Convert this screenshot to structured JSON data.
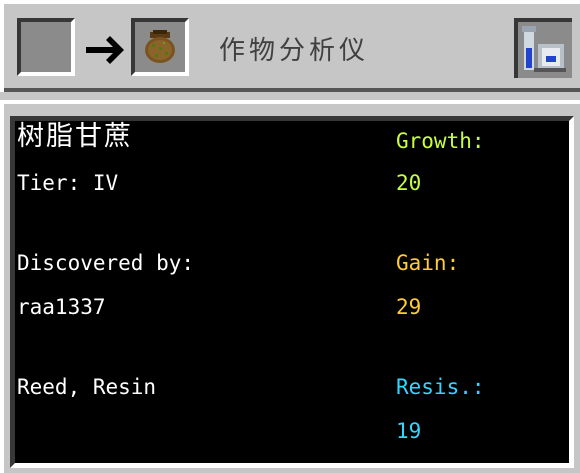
{
  "window": {
    "title": "作物分析仪"
  },
  "crop": {
    "name": "树脂甘蔗",
    "tier_text": "Tier: IV",
    "discovered_label": "Discovered by:",
    "discovered_by": "raa1337",
    "attributes": "Reed, Resin"
  },
  "stats": {
    "growth_label": "Growth:",
    "growth_value": "20",
    "gain_label": "Gain:",
    "gain_value": "29",
    "resis_label": "Resis.:",
    "resis_value": "19"
  },
  "colors": {
    "growth": "#c8ff3c",
    "gain": "#ffcc33",
    "resis": "#33d6ff",
    "panel": "#c6c6c6"
  },
  "icons": {
    "output_item": "seed-bag-icon",
    "arrow": "arrow-right-icon",
    "machine": "crop-analyzer-icon"
  }
}
